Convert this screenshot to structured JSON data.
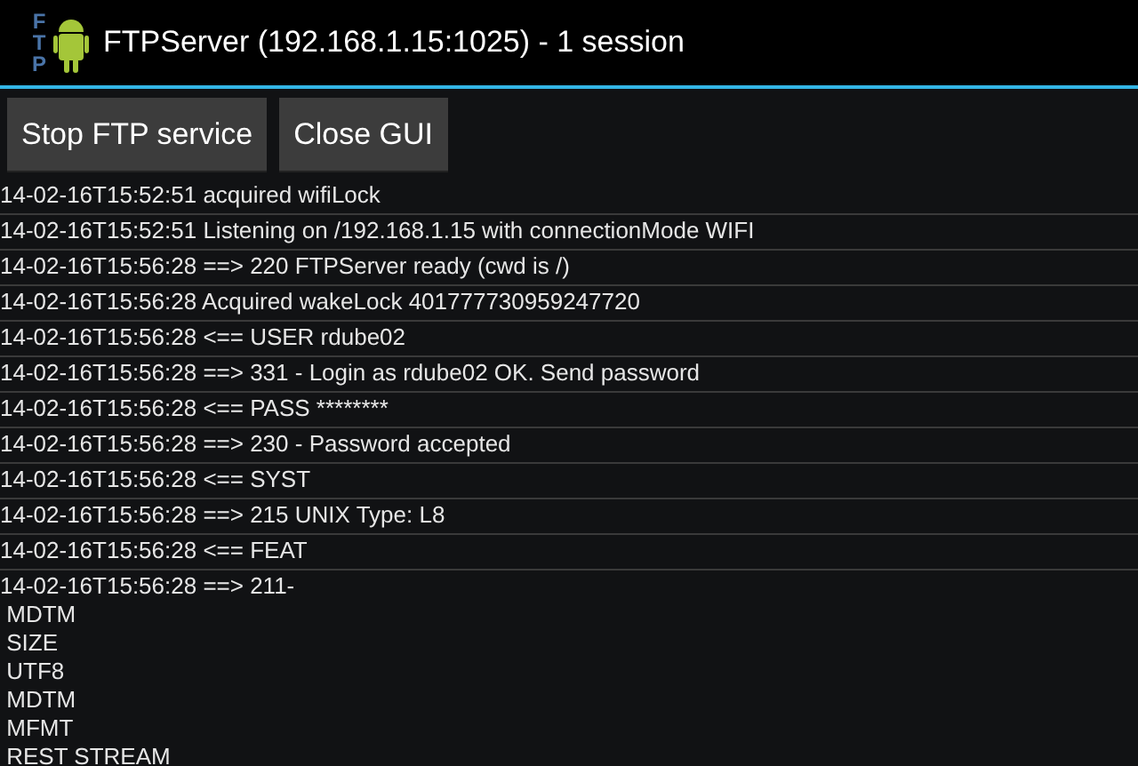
{
  "action_bar": {
    "icon_text": "FTP",
    "title": "FTPServer (192.168.1.15:1025) - 1 session"
  },
  "buttons": [
    "Stop FTP service",
    "Close GUI"
  ],
  "log": [
    {
      "lines": [
        "14-02-16T15:52:51 acquired wifiLock"
      ]
    },
    {
      "lines": [
        "14-02-16T15:52:51 Listening on /192.168.1.15 with connectionMode WIFI"
      ]
    },
    {
      "lines": [
        "14-02-16T15:56:28 ==> 220 FTPServer ready (cwd is /)"
      ]
    },
    {
      "lines": [
        "14-02-16T15:56:28 Acquired wakeLock 401777730959247720"
      ]
    },
    {
      "lines": [
        "14-02-16T15:56:28 <== USER rdube02"
      ]
    },
    {
      "lines": [
        "14-02-16T15:56:28 ==> 331 - Login as rdube02 OK. Send password"
      ]
    },
    {
      "lines": [
        "14-02-16T15:56:28 <== PASS ********"
      ]
    },
    {
      "lines": [
        "14-02-16T15:56:28 ==> 230 - Password accepted"
      ]
    },
    {
      "lines": [
        "14-02-16T15:56:28 <== SYST"
      ]
    },
    {
      "lines": [
        "14-02-16T15:56:28 ==> 215 UNIX Type: L8"
      ]
    },
    {
      "lines": [
        "14-02-16T15:56:28 <== FEAT"
      ]
    },
    {
      "lines": [
        "14-02-16T15:56:28 ==> 211-",
        " MDTM",
        " SIZE",
        " UTF8",
        " MDTM",
        " MFMT",
        " REST STREAM"
      ]
    }
  ]
}
